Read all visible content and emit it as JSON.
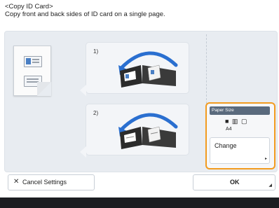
{
  "header": {
    "title": "<Copy ID Card>",
    "description": "Copy front and back sides of ID card on a single page."
  },
  "steps": [
    {
      "label": "1)"
    },
    {
      "label": "2)"
    }
  ],
  "paper_size": {
    "title": "Paper Size",
    "icons": "■ ▥ ▢",
    "value": "A4",
    "change_label": "Change"
  },
  "footer": {
    "cancel_label": "Cancel Settings",
    "ok_label": "OK"
  },
  "colors": {
    "accent": "#f29b1f",
    "panel": "#e8ecf1",
    "arrow_blue": "#2a6fd0"
  },
  "icons": [
    "close-icon",
    "id-card-icon",
    "scanner-icon",
    "curved-arrow-icon",
    "paper-size-icon",
    "corner-arrow-icon"
  ]
}
